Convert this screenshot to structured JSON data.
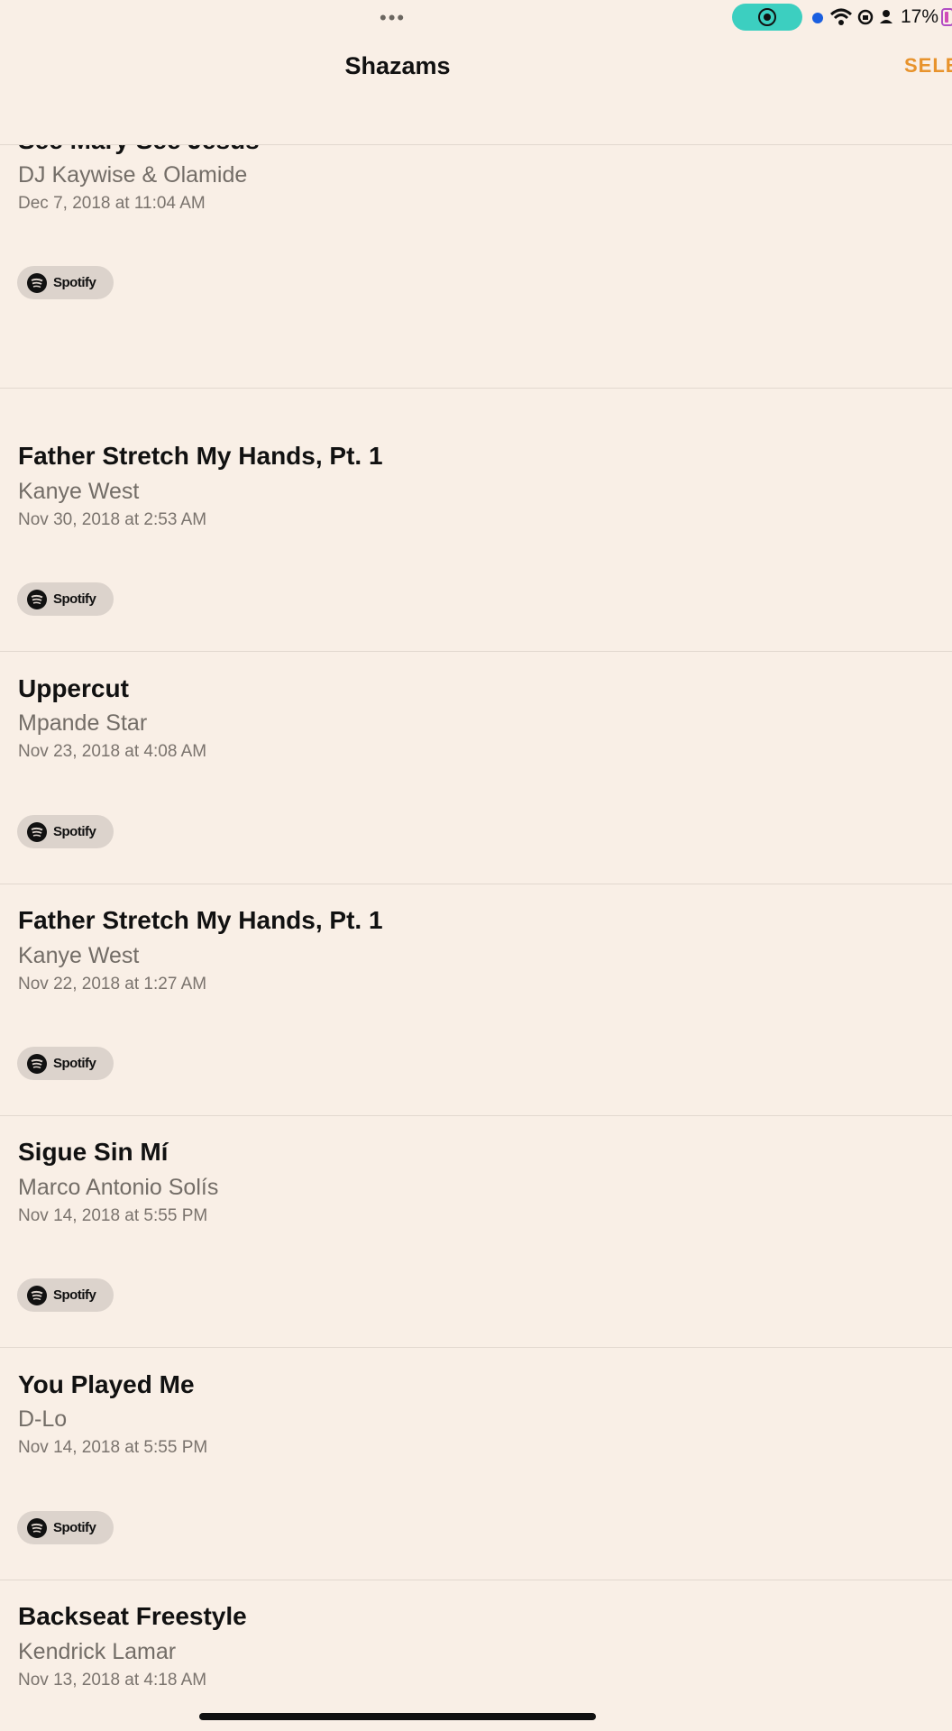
{
  "status": {
    "battery_percent": "17%",
    "recording": true
  },
  "nav": {
    "title": "Shazams",
    "select_label": "SELECT"
  },
  "items": [
    {
      "title": "See Mary See Jesus",
      "artist": "DJ Kaywise & Olamide",
      "date": "Dec 7, 2018 at 11:04 AM",
      "spotify_label": "Spotify"
    },
    {
      "title": "Father Stretch My Hands, Pt. 1",
      "artist": "Kanye West",
      "date": "Nov 30, 2018 at 2:53 AM",
      "spotify_label": "Spotify"
    },
    {
      "title": "Uppercut",
      "artist": "Mpande Star",
      "date": "Nov 23, 2018 at 4:08 AM",
      "spotify_label": "Spotify"
    },
    {
      "title": "Father Stretch My Hands, Pt. 1",
      "artist": "Kanye West",
      "date": "Nov 22, 2018 at 1:27 AM",
      "spotify_label": "Spotify"
    },
    {
      "title": "Sigue Sin Mí",
      "artist": "Marco Antonio Solís",
      "date": "Nov 14, 2018 at 5:55 PM",
      "spotify_label": "Spotify"
    },
    {
      "title": "You Played Me",
      "artist": "D-Lo",
      "date": "Nov 14, 2018 at 5:55 PM",
      "spotify_label": "Spotify"
    },
    {
      "title": "Backseat Freestyle",
      "artist": "Kendrick Lamar",
      "date": "Nov 13, 2018 at 4:18 AM"
    }
  ],
  "colors": {
    "accent": "#e8932c",
    "background": "#f9efe6",
    "record": "#3ccfc0"
  }
}
